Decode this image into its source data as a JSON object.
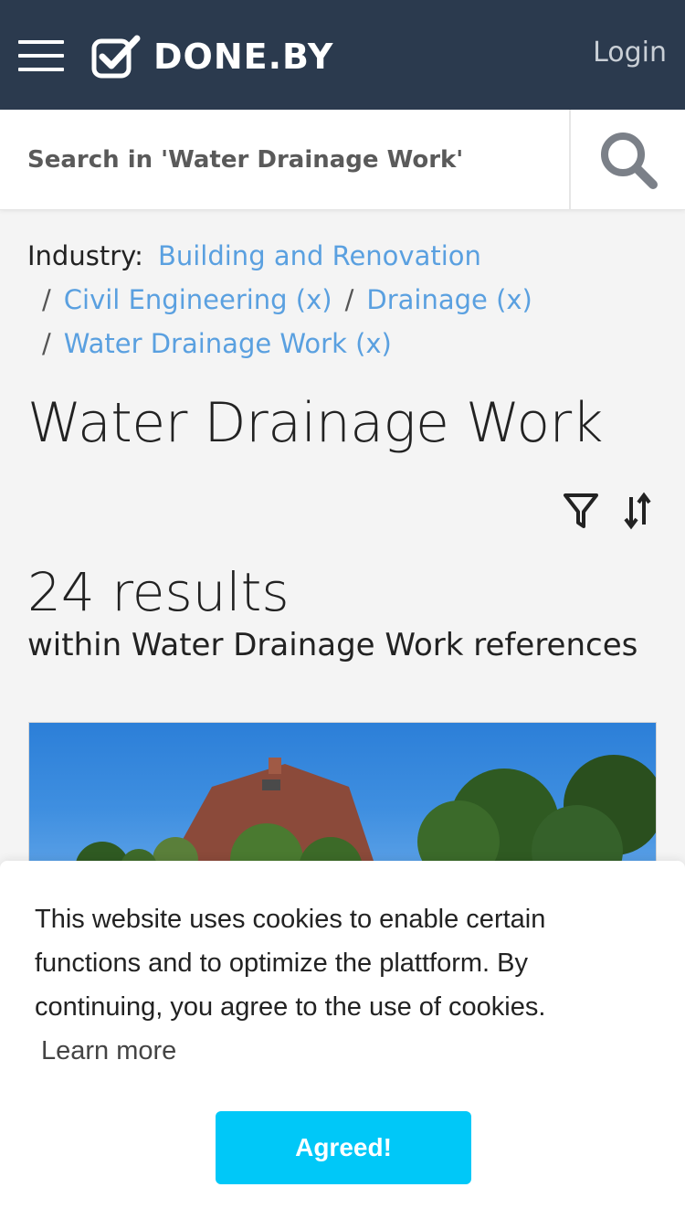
{
  "header": {
    "brand": "DONE.BY",
    "login_label": "Login",
    "background": "#2b3a4e"
  },
  "search": {
    "placeholder": "Search in 'Water Drainage Work'",
    "icon": "search-icon"
  },
  "breadcrumb": {
    "label": "Industry:",
    "items": [
      "Building and Renovation",
      "Civil Engineering (x)",
      "Drainage (x)",
      "Water Drainage Work (x)"
    ],
    "separator": "/",
    "link_color": "#5aa0e0"
  },
  "page": {
    "title": "Water Drainage Work",
    "results_count": "24 results",
    "results_sub": "within Water Drainage Work references"
  },
  "tools": {
    "filter_icon": "filter-icon",
    "sort_icon": "sort-icon"
  },
  "cookie": {
    "text": "This website uses cookies to enable certain functions and to optimize the plattform. By continuing, you agree to the use of cookies.",
    "learn_more": "Learn more",
    "button_label": "Agreed!",
    "button_color": "#00c8f8"
  }
}
